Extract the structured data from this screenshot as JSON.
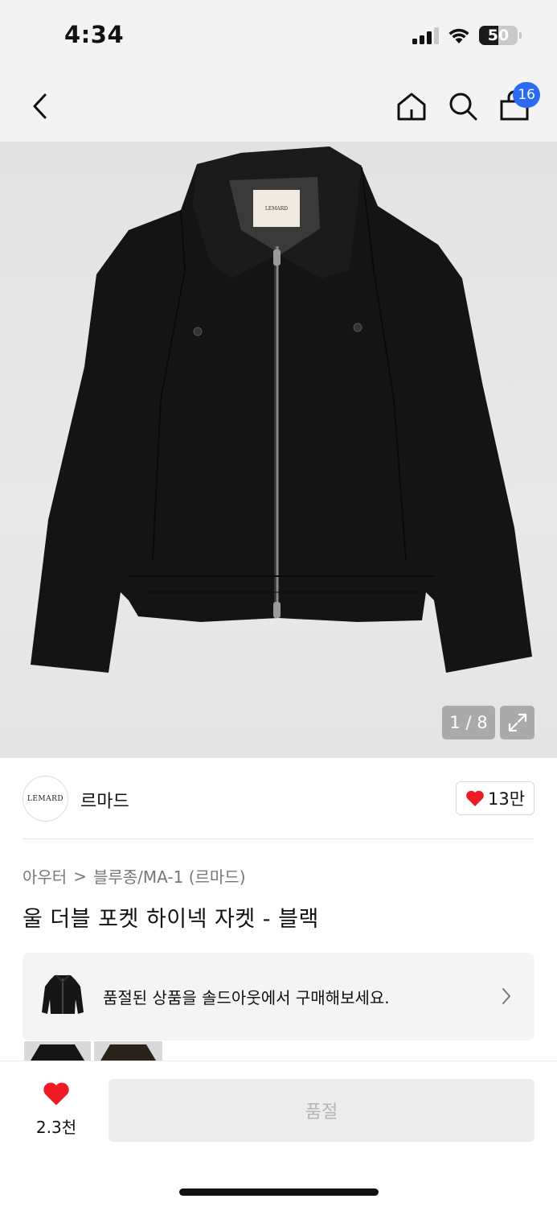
{
  "status_bar": {
    "time": "4:34",
    "battery": "50",
    "battery_level": 0.5,
    "signal_bars": 3
  },
  "nav": {
    "back_icon": "chevron-left-icon",
    "home_icon": "home-icon",
    "search_icon": "search-icon",
    "cart_icon": "shopping-bag-icon",
    "cart_count": "16"
  },
  "product_image": {
    "counter": "1 / 8",
    "label_text": "LEMARD",
    "expand_icon": "expand-icon"
  },
  "brand": {
    "logo_text": "LEMARD",
    "name": "르마드",
    "like_count": "13만"
  },
  "breadcrumb": {
    "category": "아우터",
    "separator": ">",
    "subcategory": "블루종/MA-1 (르마드)"
  },
  "product": {
    "title": "울 더블 포켓 하이넥 자켓 - 블랙"
  },
  "soldout_banner": {
    "text": "품절된 상품을 솔드아웃에서 구매해보세요."
  },
  "bottom_bar": {
    "wish_count": "2.3천",
    "buy_label": "품절"
  },
  "colors": {
    "accent_badge": "#2a6bf2",
    "heart_red": "#ee1b24",
    "disabled_button": "#ececec"
  }
}
